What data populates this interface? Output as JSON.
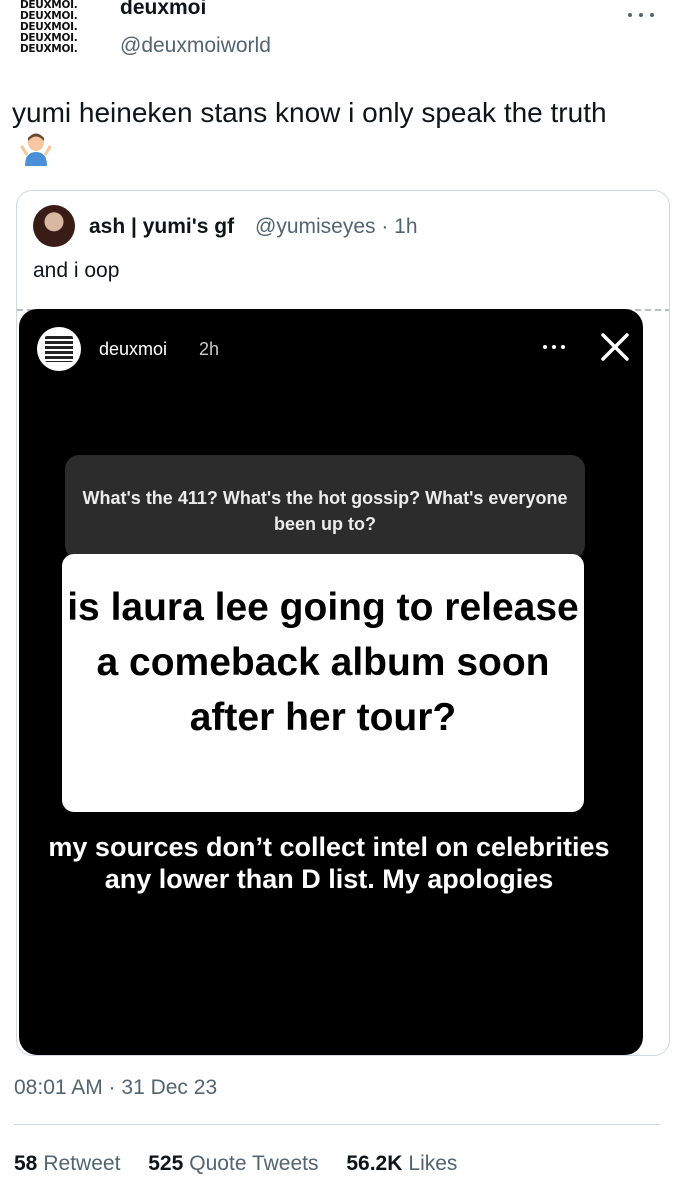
{
  "tweet": {
    "logo_lines": [
      "DEUXMOI.",
      "DEUXMOI.",
      "DEUXMOI.",
      "DEUXMOI.",
      "DEUXMOI."
    ],
    "display_name": "deuxmoi",
    "handle": "@deuxmoiworld",
    "text": "yumi heineken stans know i only speak the truth",
    "emoji_icon": "person-shrugging-icon",
    "timestamp": "08:01 AM · 31 Dec 23"
  },
  "quote": {
    "name": "ash | yumi's gf",
    "handle_time": "@yumiseyes · 1h",
    "text": "and i oop",
    "story": {
      "account": "deuxmoi",
      "age": "2h",
      "question": "What's the 411? What's the hot gossip? What's everyone been up to?",
      "answer": "is laura lee going to release a comeback album soon after her tour?",
      "reply": "my sources don’t collect intel on celebrities any lower than D list. My apologies"
    }
  },
  "stats": {
    "retweets_count": "58",
    "retweets_label": "Retweet",
    "quotes_count": "525",
    "quotes_label": "Quote Tweets",
    "likes_count": "56.2K",
    "likes_label": "Likes"
  },
  "colors": {
    "text_primary": "#0f1419",
    "text_secondary": "#536471",
    "border": "#cfd9de"
  }
}
